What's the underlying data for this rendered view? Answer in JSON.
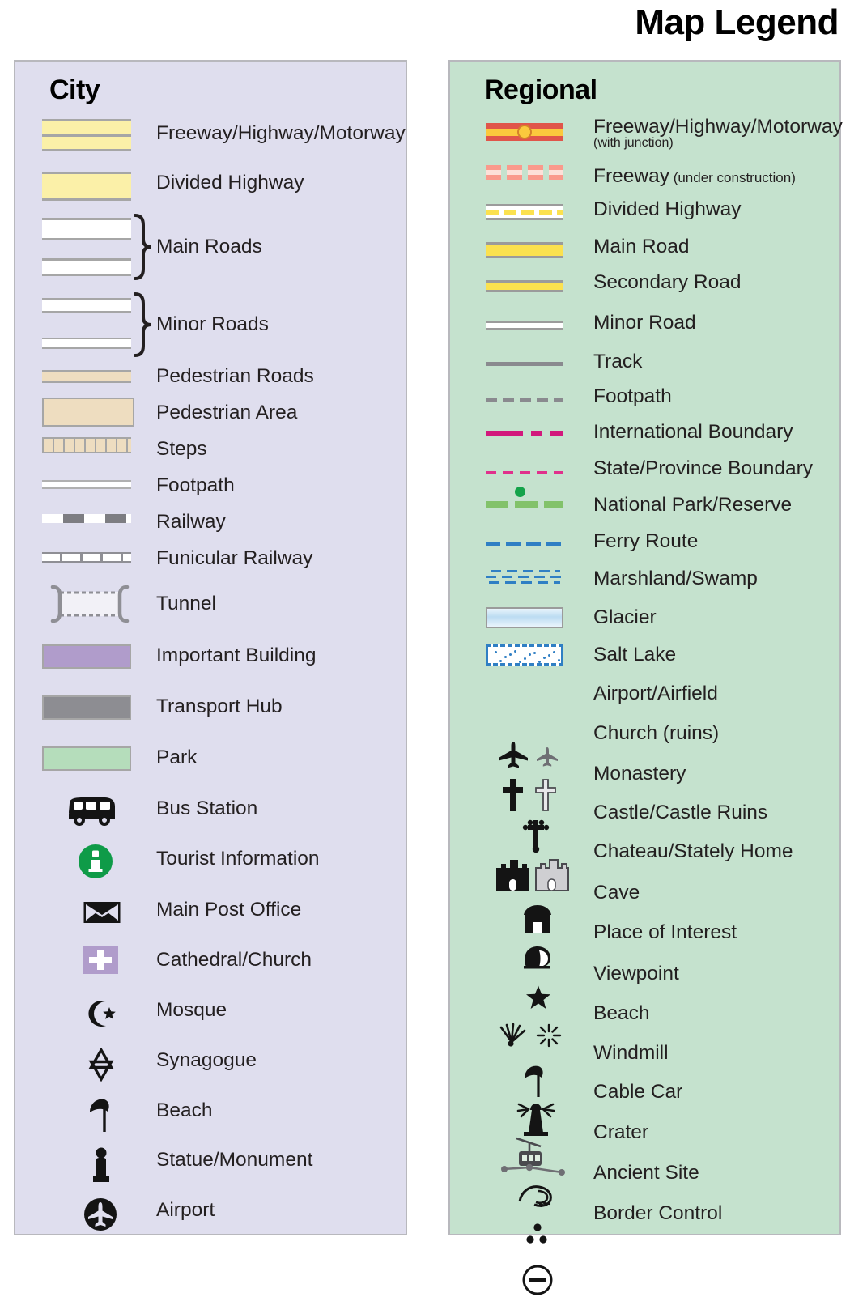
{
  "title": "Map Legend",
  "city": {
    "heading": "City",
    "items": [
      {
        "label": "Freeway/Highway/Motorway",
        "symbol": "freeway-band"
      },
      {
        "label": "Divided Highway",
        "symbol": "divided-highway-band"
      },
      {
        "label": "Main Roads",
        "symbol": "main-roads-pair-braced"
      },
      {
        "label": "Minor Roads",
        "symbol": "minor-roads-pair-braced"
      },
      {
        "label": "Pedestrian Roads",
        "symbol": "pedestrian-road-band"
      },
      {
        "label": "Pedestrian Area",
        "symbol": "pedestrian-area-block"
      },
      {
        "label": "Steps",
        "symbol": "steps-band"
      },
      {
        "label": "Footpath",
        "symbol": "footpath-line"
      },
      {
        "label": "Railway",
        "symbol": "railway-dashed-line"
      },
      {
        "label": "Funicular Railway",
        "symbol": "funicular-ticked-line"
      },
      {
        "label": "Tunnel",
        "symbol": "tunnel-bracket-symbol"
      },
      {
        "label": "Important Building",
        "symbol": "important-building-swatch"
      },
      {
        "label": "Transport Hub",
        "symbol": "transport-hub-swatch"
      },
      {
        "label": "Park",
        "symbol": "park-swatch"
      },
      {
        "label": "Bus Station",
        "symbol": "bus-icon"
      },
      {
        "label": "Tourist Information",
        "symbol": "information-icon"
      },
      {
        "label": "Main Post Office",
        "symbol": "envelope-icon"
      },
      {
        "label": "Cathedral/Church",
        "symbol": "church-cross-icon"
      },
      {
        "label": "Mosque",
        "symbol": "crescent-star-icon"
      },
      {
        "label": "Synagogue",
        "symbol": "star-of-david-icon"
      },
      {
        "label": "Beach",
        "symbol": "beach-umbrella-icon"
      },
      {
        "label": "Statue/Monument",
        "symbol": "statue-icon"
      },
      {
        "label": "Airport",
        "symbol": "airport-circle-icon"
      }
    ],
    "colors": {
      "panel_background": "#dfdeee",
      "panel_border": "#b8b8bd",
      "highway_fill": "#fbf0a8",
      "road_casing": "#a6a6a6",
      "pedestrian_fill": "#eeddc0",
      "important_building": "#b09ccb",
      "transport_hub": "#8d8d92",
      "park": "#b5ddbb",
      "tourist_info_green": "#0f9b48"
    }
  },
  "regional": {
    "heading": "Regional",
    "items": [
      {
        "label": "Freeway/Highway/Motorway",
        "sublabel": "(with junction)",
        "symbol": "freeway-junction-line"
      },
      {
        "label": "Freeway",
        "sublabel": "(under construction)",
        "symbol": "freeway-under-construction-line"
      },
      {
        "label": "Divided Highway",
        "symbol": "divided-highway-line"
      },
      {
        "label": "Main Road",
        "symbol": "main-road-line"
      },
      {
        "label": "Secondary Road",
        "symbol": "secondary-road-line"
      },
      {
        "label": "Minor Road",
        "symbol": "minor-road-line"
      },
      {
        "label": "Track",
        "symbol": "track-line"
      },
      {
        "label": "Footpath",
        "symbol": "footpath-dashed-line"
      },
      {
        "label": "International Boundary",
        "symbol": "international-boundary-line"
      },
      {
        "label": "State/Province Boundary",
        "symbol": "state-boundary-line"
      },
      {
        "label": "National Park/Reserve",
        "symbol": "national-park-line"
      },
      {
        "label": "Ferry Route",
        "symbol": "ferry-route-line"
      },
      {
        "label": "Marshland/Swamp",
        "symbol": "marshland-pattern"
      },
      {
        "label": "Glacier",
        "symbol": "glacier-swatch"
      },
      {
        "label": "Salt Lake",
        "symbol": "salt-lake-swatch"
      },
      {
        "label": "Airport/Airfield",
        "symbol": "airplane-pair-icon"
      },
      {
        "label": "Church (ruins)",
        "symbol": "cross-pair-icon"
      },
      {
        "label": "Monastery",
        "symbol": "monastery-cross-icon"
      },
      {
        "label": "Castle/Castle Ruins",
        "symbol": "castle-pair-icon"
      },
      {
        "label": "Chateau/Stately Home",
        "symbol": "chateau-icon"
      },
      {
        "label": "Cave",
        "symbol": "cave-icon"
      },
      {
        "label": "Place of Interest",
        "symbol": "star-icon"
      },
      {
        "label": "Viewpoint",
        "symbol": "viewpoint-pair-icon"
      },
      {
        "label": "Beach",
        "symbol": "beach-umbrella-icon"
      },
      {
        "label": "Windmill",
        "symbol": "windmill-icon"
      },
      {
        "label": "Cable Car",
        "symbol": "cable-car-icon"
      },
      {
        "label": "Crater",
        "symbol": "crater-icon"
      },
      {
        "label": "Ancient Site",
        "symbol": "ancient-site-dots-icon"
      },
      {
        "label": "Border Control",
        "symbol": "border-control-icon"
      }
    ],
    "colors": {
      "panel_background": "#c5e2ce",
      "panel_border": "#b8b8bd",
      "freeway_red": "#e0554a",
      "freeway_yellow": "#fbc93d",
      "under_construction": "#fa9a8c",
      "road_yellow": "#fbe14f",
      "road_casing": "#9b9b9b",
      "international_boundary": "#d2187c",
      "state_boundary": "#e0318c",
      "national_park_green": "#82c26a",
      "park_dot_green": "#14a34a",
      "water_blue": "#2f7fc4",
      "glacier_blue": "#bcdcf2"
    }
  }
}
